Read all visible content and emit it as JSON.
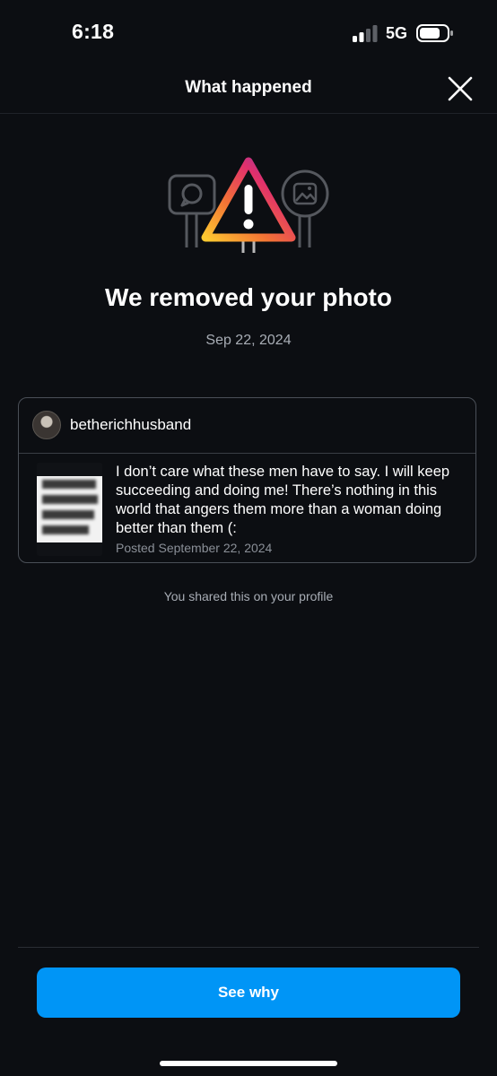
{
  "status_bar": {
    "time": "6:18",
    "network": "5G",
    "icons": [
      "signal-icon",
      "battery-icon"
    ]
  },
  "header": {
    "title": "What happened",
    "close_icon": "close-icon"
  },
  "notice": {
    "illustration_icon": "warning-triangle-icon",
    "title": "We removed your photo",
    "date": "Sep 22, 2024"
  },
  "post": {
    "username": "betherichhusband",
    "caption": "I don’t care what these men have to say. I will keep succeeding and doing me! There’s nothing in this world that angers them more than a woman doing better than them (:",
    "posted_date": "Posted September 22, 2024"
  },
  "share_note": "You shared this on your profile",
  "actions": {
    "see_why_label": "See why"
  },
  "colors": {
    "background": "#0c0e12",
    "primary_button": "#0095f6",
    "secondary_text": "#a8adb5",
    "warning_gradient": [
      "#fdc830",
      "#f37335",
      "#e1306c",
      "#833ab4"
    ]
  }
}
